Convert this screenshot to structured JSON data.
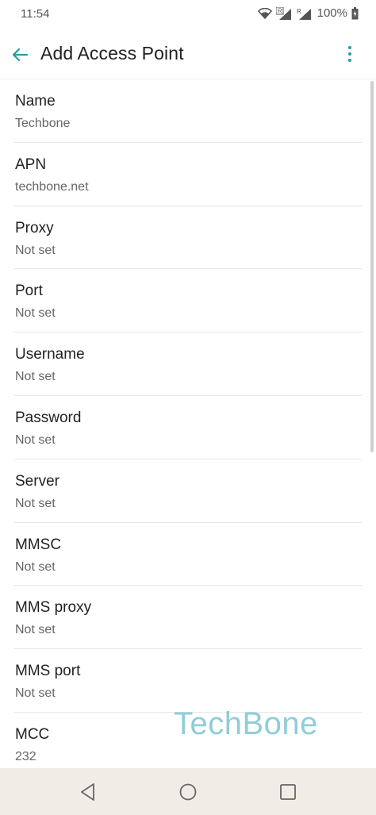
{
  "status": {
    "time": "11:54",
    "battery": "100%"
  },
  "app_bar": {
    "title": "Add Access Point",
    "accent": "#2a9aa8"
  },
  "fields": [
    {
      "label": "Name",
      "value": "Techbone"
    },
    {
      "label": "APN",
      "value": "techbone.net"
    },
    {
      "label": "Proxy",
      "value": "Not set"
    },
    {
      "label": "Port",
      "value": "Not set"
    },
    {
      "label": "Username",
      "value": "Not set"
    },
    {
      "label": "Password",
      "value": "Not set"
    },
    {
      "label": "Server",
      "value": "Not set"
    },
    {
      "label": "MMSC",
      "value": "Not set"
    },
    {
      "label": "MMS proxy",
      "value": "Not set"
    },
    {
      "label": "MMS port",
      "value": "Not set"
    },
    {
      "label": "MCC",
      "value": "232"
    }
  ],
  "watermark": "TechBone",
  "icons": {
    "back": "arrow-back-icon",
    "overflow": "more-vert-icon",
    "nav_back": "triangle-back-icon",
    "nav_home": "circle-home-icon",
    "nav_recent": "square-recents-icon"
  }
}
